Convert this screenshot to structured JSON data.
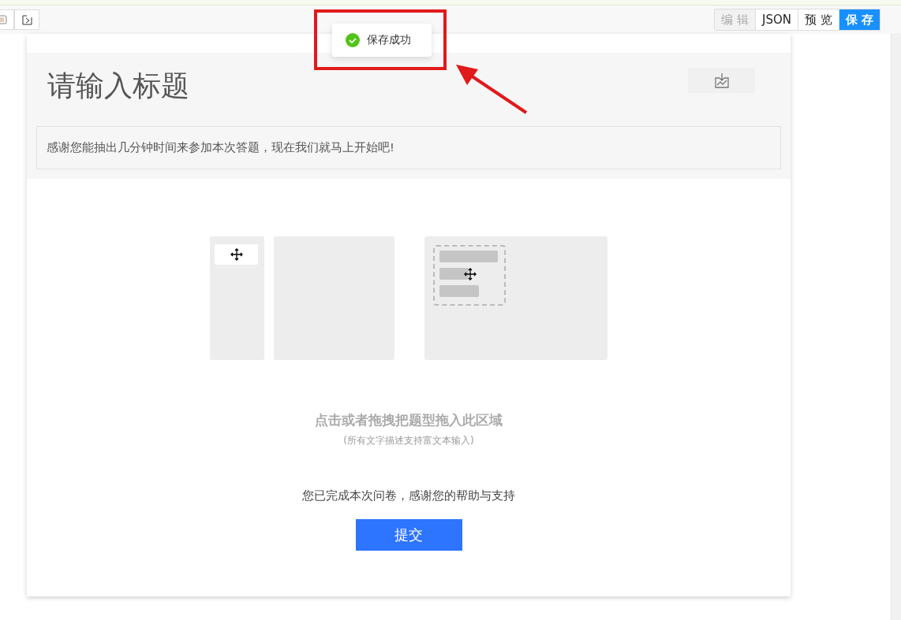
{
  "toolbar": {
    "mode_buttons": [
      {
        "label": "编 辑",
        "kind": "disabled"
      },
      {
        "label": "JSON",
        "kind": "default"
      },
      {
        "label": "预 览",
        "kind": "default"
      },
      {
        "label": "保 存",
        "kind": "primary"
      }
    ]
  },
  "toast": {
    "message": "保存成功"
  },
  "survey": {
    "title": "请输入标题",
    "description": "感谢您能抽出几分钟时间来参加本次答题，现在我们就马上开始吧!",
    "empty_hint": "点击或者拖拽把题型拖入此区域",
    "empty_subhint": "(所有文字描述支持富文本输入)",
    "end_message": "您已完成本次问卷，感谢您的帮助与支持",
    "submit_label": "提交"
  }
}
